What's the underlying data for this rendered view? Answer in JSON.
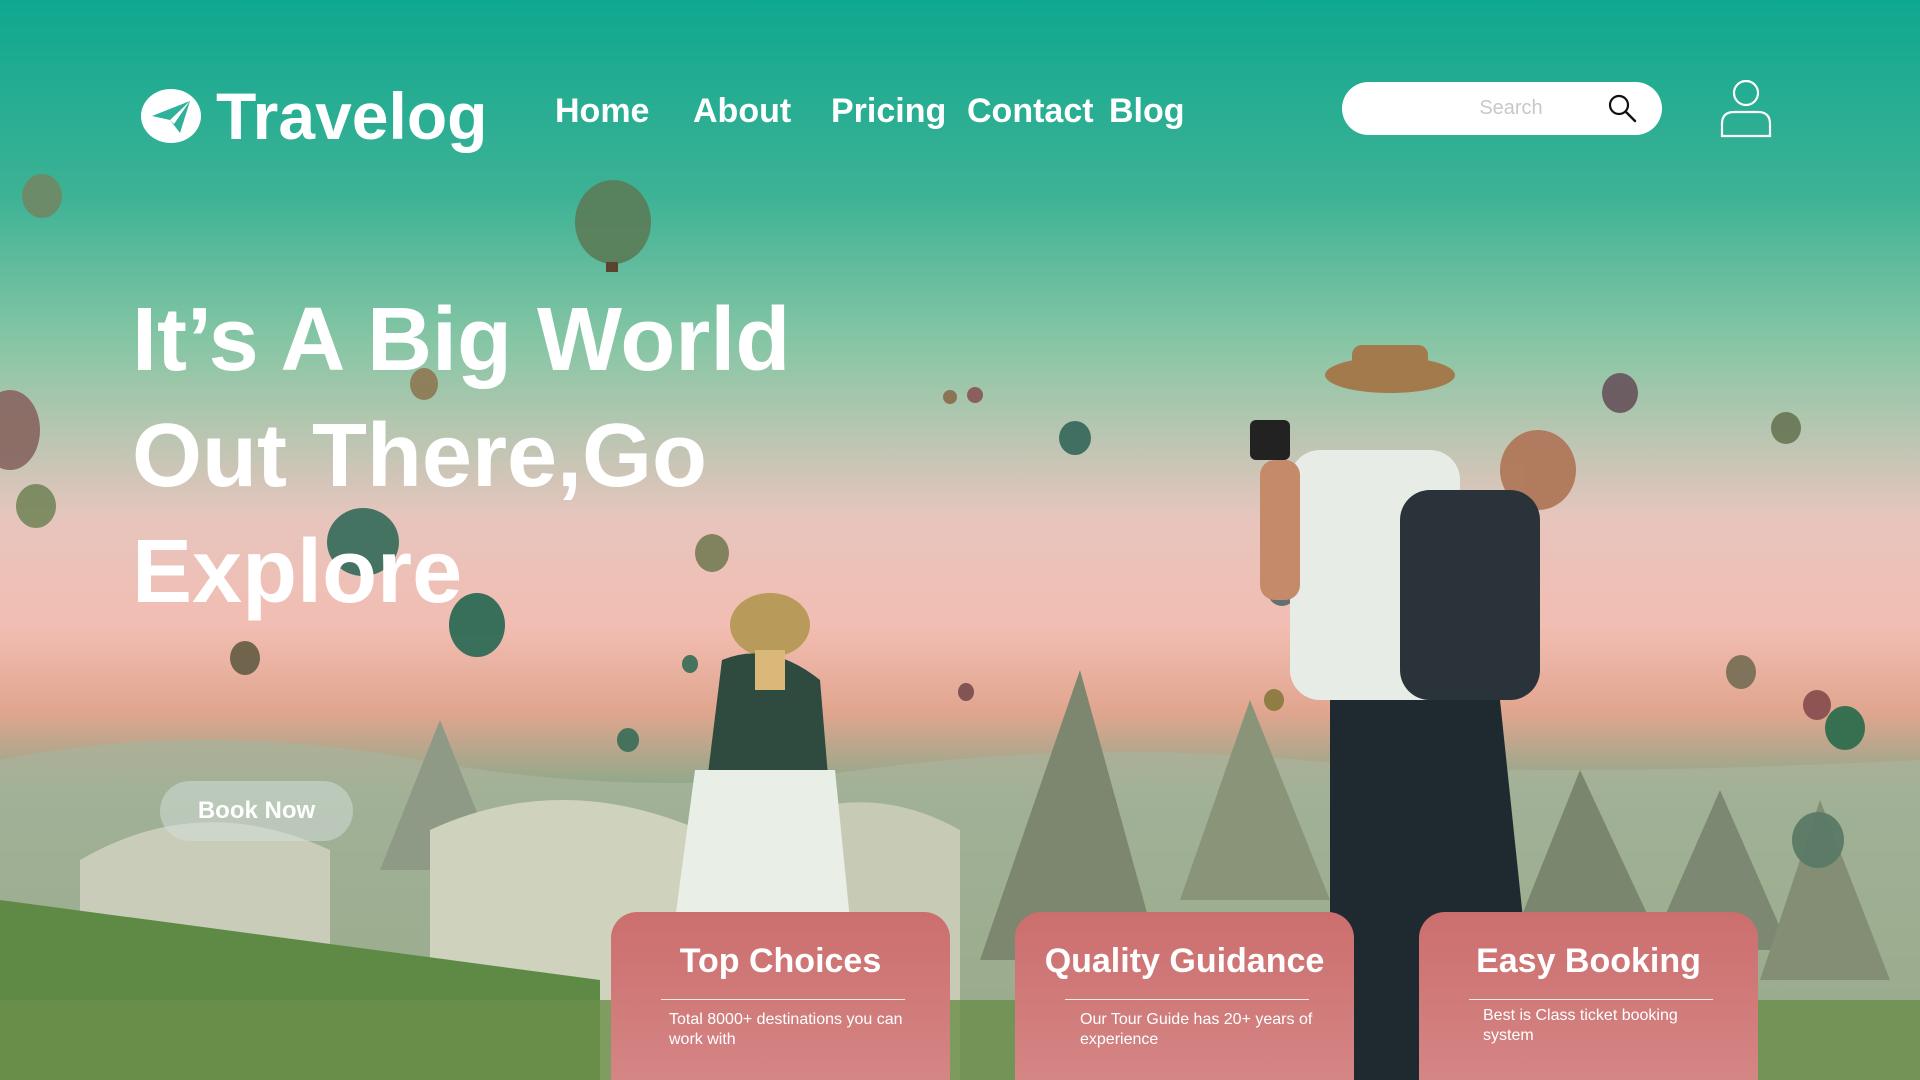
{
  "brand": {
    "name": "Travelog",
    "logo_icon": "paper-plane-icon"
  },
  "nav": {
    "items": [
      "Home",
      "About",
      "Pricing",
      "Contact",
      "Blog"
    ]
  },
  "search": {
    "placeholder": "Search",
    "icon": "search-icon"
  },
  "user": {
    "icon": "user-icon"
  },
  "hero": {
    "headline_lines": [
      "It’s A Big World",
      "Out There,Go",
      "Explore"
    ],
    "cta_label": "Book Now"
  },
  "features": [
    {
      "title": "Top Choices",
      "text": "Total 8000+ destinations you can work with"
    },
    {
      "title": "Quality Guidance",
      "text": "Our Tour Guide has 20+ years of experience"
    },
    {
      "title": "Easy Booking",
      "text": "Best is Class ticket booking system"
    }
  ],
  "colors": {
    "header_teal": "#0ea890",
    "card": "#cc6e6e",
    "text": "#ffffff"
  }
}
